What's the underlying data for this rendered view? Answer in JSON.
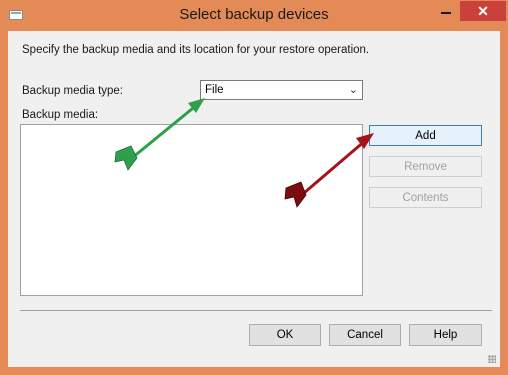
{
  "window": {
    "title": "Select backup devices",
    "close_glyph": "✕"
  },
  "instructions": "Specify the backup media and its location for your restore operation.",
  "media_type": {
    "label": "Backup media type:",
    "value": "File"
  },
  "media": {
    "label": "Backup media:"
  },
  "buttons": {
    "add": "Add",
    "remove": "Remove",
    "contents": "Contents",
    "ok": "OK",
    "cancel": "Cancel",
    "help": "Help"
  },
  "colors": {
    "frame": "#e38a56",
    "close_bg": "#c9413a",
    "green_arrow": "#2ea04b",
    "red_arrow": "#a5121a"
  }
}
